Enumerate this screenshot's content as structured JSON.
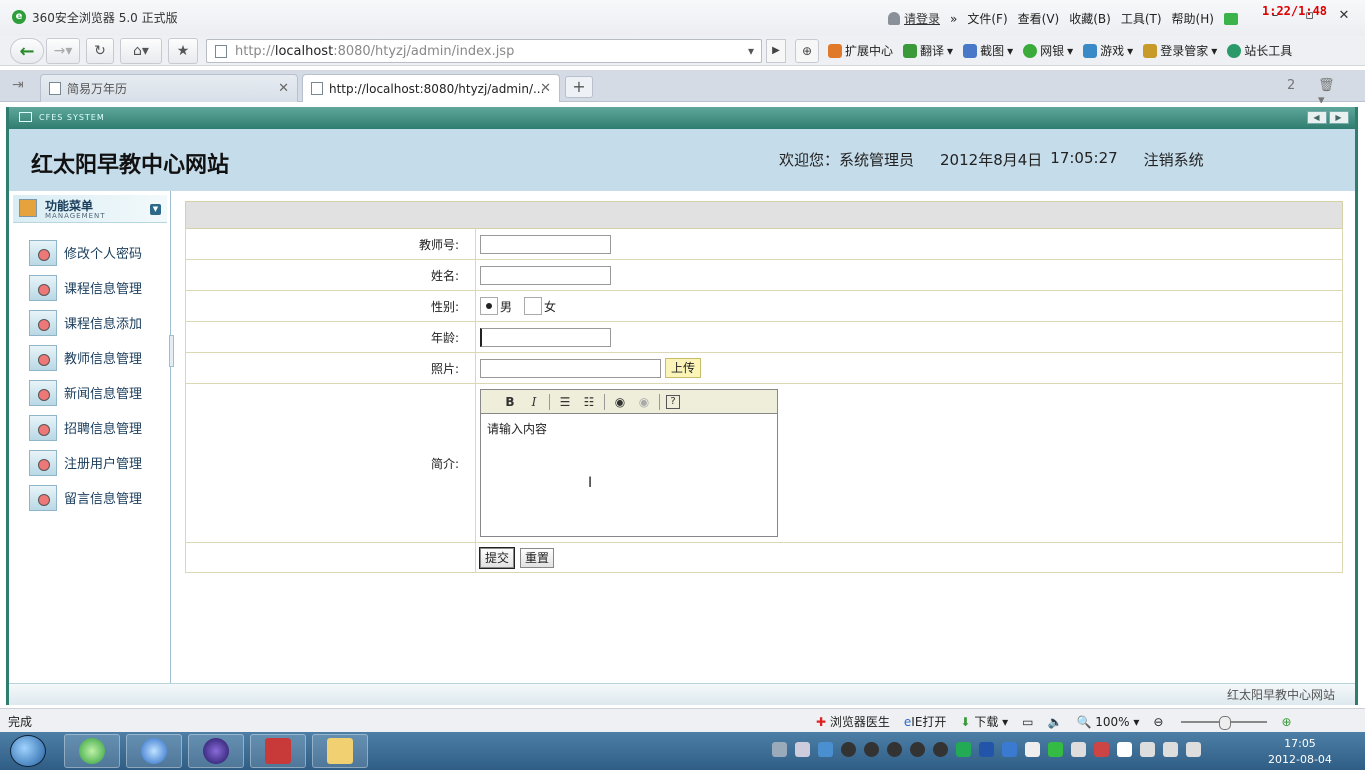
{
  "browser": {
    "app_title": "360安全浏览器 5.0 正式版",
    "login": "请登录",
    "menus": [
      "文件(F)",
      "查看(V)",
      "收藏(B)",
      "工具(T)",
      "帮助(H)"
    ],
    "recording_time": "1:22/1:48",
    "address": {
      "prefix": "http://",
      "host": "localhost",
      "rest": ":8080/htyzj/admin/index.jsp"
    },
    "toolbar_items": [
      {
        "label": "扩展中心",
        "icon": "extension-icon",
        "color": "#e07a2a"
      },
      {
        "label": "翻译",
        "icon": "translate-icon",
        "color": "#3a9a3a"
      },
      {
        "label": "截图",
        "icon": "screenshot-icon",
        "color": "#4a78c8"
      },
      {
        "label": "网银",
        "icon": "bank-icon",
        "color": "#3aaa3a"
      },
      {
        "label": "游戏",
        "icon": "game-icon",
        "color": "#3a8ac8"
      },
      {
        "label": "登录管家",
        "icon": "key-icon",
        "color": "#c89a2a"
      },
      {
        "label": "站长工具",
        "icon": "webmaster-icon",
        "color": "#2a9a6a"
      }
    ],
    "tabs": [
      {
        "label": "简易万年历"
      },
      {
        "label": "http://localhost:8080/htyzj/admin/..."
      }
    ],
    "tab_count": "2"
  },
  "site": {
    "system_tag": "CFES SYSTEM",
    "title": "红太阳早教中心网站",
    "welcome": "欢迎您：系统管理员",
    "date": "2012年8月4日",
    "time": "17:05:27",
    "logout": "注销系统",
    "footer": "红太阳早教中心网站"
  },
  "sidebar": {
    "header": "功能菜单",
    "subheader": "MANAGEMENT",
    "items": [
      {
        "label": "修改个人密码"
      },
      {
        "label": "课程信息管理"
      },
      {
        "label": "课程信息添加"
      },
      {
        "label": "教师信息管理"
      },
      {
        "label": "新闻信息管理"
      },
      {
        "label": "招聘信息管理"
      },
      {
        "label": "注册用户管理"
      },
      {
        "label": "留言信息管理"
      }
    ]
  },
  "form": {
    "teacher_no_label": "教师号:",
    "name_label": "姓名:",
    "gender_label": "性别:",
    "gender_male": "男",
    "gender_female": "女",
    "age_label": "年龄:",
    "photo_label": "照片:",
    "upload_button": "上传",
    "intro_label": "简介:",
    "editor_placeholder": "请输入内容",
    "submit": "提交",
    "reset": "重置"
  },
  "statusbar": {
    "status": "完成",
    "doctor": "浏览器医生",
    "ie_open": "IE打开",
    "download": "下载",
    "zoom": "100%"
  },
  "taskbar": {
    "time": "17:05",
    "date": "2012-08-04"
  }
}
